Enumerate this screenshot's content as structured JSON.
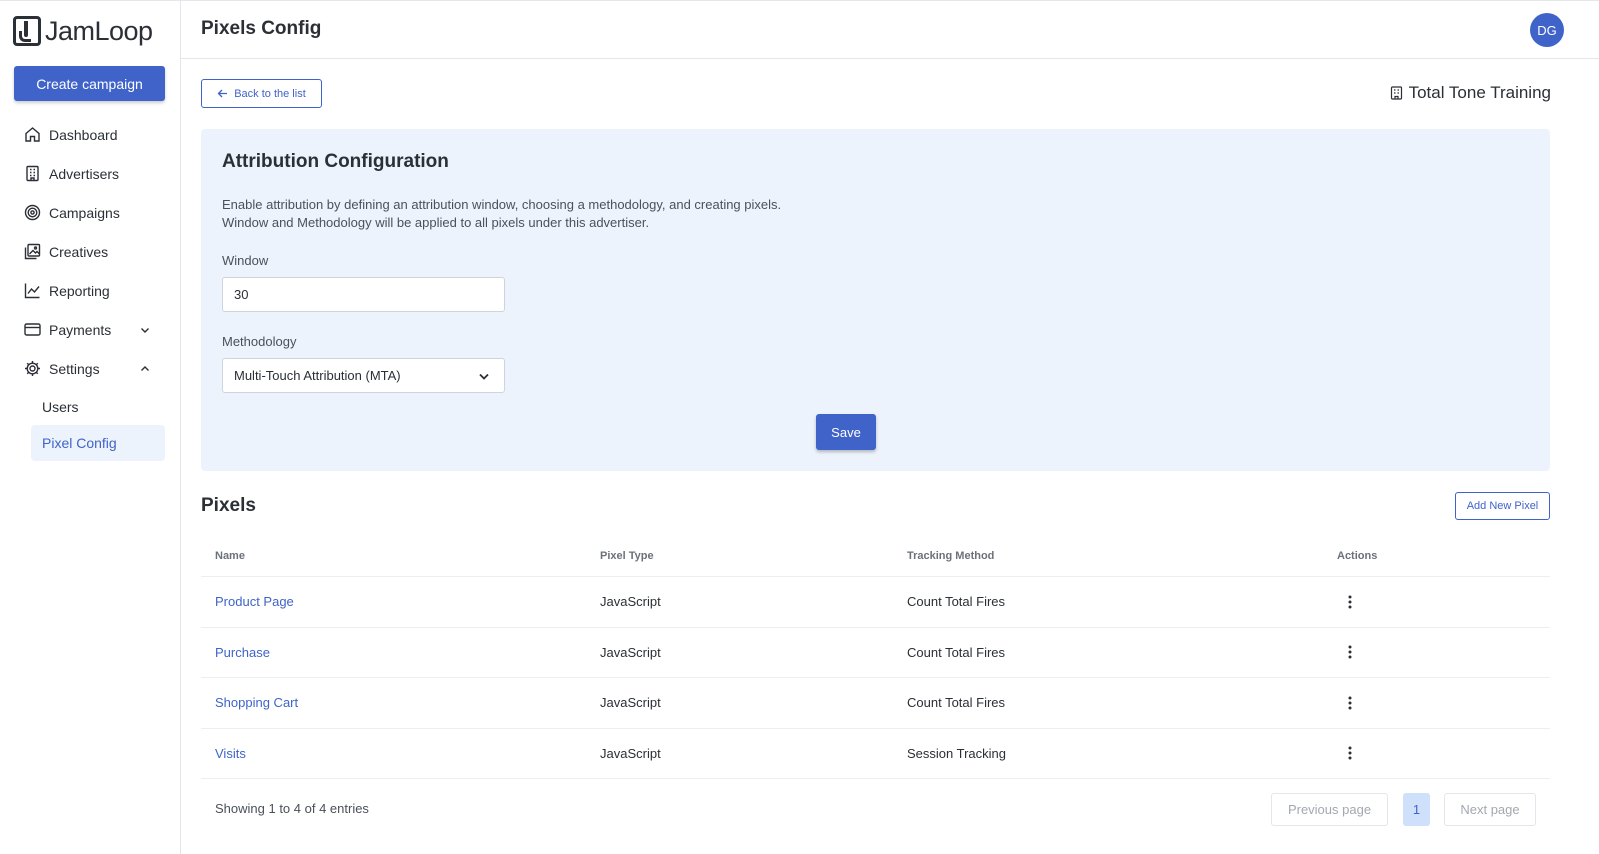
{
  "brand": {
    "name": "JamLoop",
    "accent": "#3f63c9"
  },
  "sidebar": {
    "create_label": "Create campaign",
    "items": [
      {
        "label": "Dashboard",
        "icon": "home-icon"
      },
      {
        "label": "Advertisers",
        "icon": "building-icon"
      },
      {
        "label": "Campaigns",
        "icon": "target-icon"
      },
      {
        "label": "Creatives",
        "icon": "image-icon"
      },
      {
        "label": "Reporting",
        "icon": "chart-line-icon"
      },
      {
        "label": "Payments",
        "icon": "credit-card-icon"
      },
      {
        "label": "Settings",
        "icon": "gear-icon"
      }
    ],
    "sub_items": [
      {
        "label": "Users"
      },
      {
        "label": "Pixel Config"
      }
    ]
  },
  "header": {
    "title": "Pixels Config",
    "avatar": "DG"
  },
  "back_label": "Back to the list",
  "advertiser_name": "Total Tone Training",
  "attribution": {
    "title": "Attribution Configuration",
    "desc_line1": "Enable attribution by defining an attribution window, choosing a methodology, and creating pixels.",
    "desc_line2": "Window and Methodology will be applied to all pixels under this advertiser.",
    "window_label": "Window",
    "window_value": "30",
    "methodology_label": "Methodology",
    "methodology_value": "Multi-Touch Attribution (MTA)",
    "save_label": "Save"
  },
  "pixels": {
    "title": "Pixels",
    "add_label": "Add New Pixel",
    "columns": [
      "Name",
      "Pixel Type",
      "Tracking Method",
      "Actions"
    ],
    "rows": [
      {
        "name": "Product Page",
        "type": "JavaScript",
        "method": "Count Total Fires"
      },
      {
        "name": "Purchase",
        "type": "JavaScript",
        "method": "Count Total Fires"
      },
      {
        "name": "Shopping Cart",
        "type": "JavaScript",
        "method": "Count Total Fires"
      },
      {
        "name": "Visits",
        "type": "JavaScript",
        "method": "Session Tracking"
      }
    ],
    "showing": "Showing 1 to 4 of 4 entries",
    "prev_label": "Previous page",
    "page": "1",
    "next_label": "Next page"
  }
}
